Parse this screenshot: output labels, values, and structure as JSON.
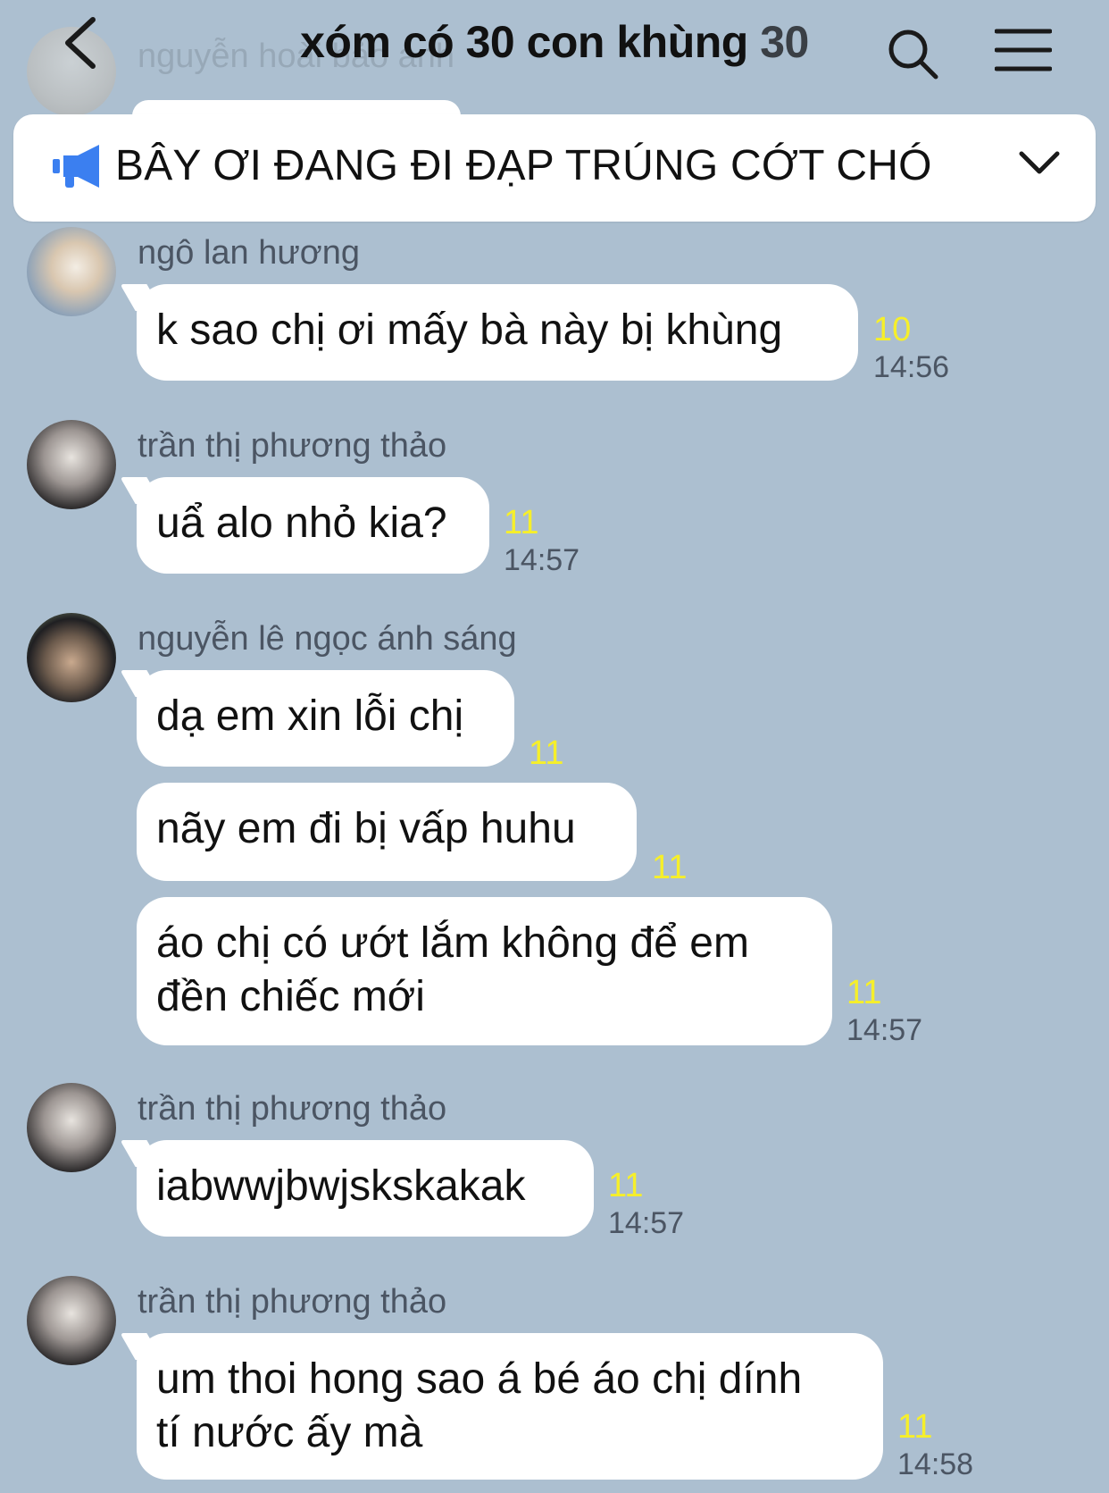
{
  "header": {
    "title": "xóm có 30 con khùng",
    "member_count": "30",
    "back_icon": "chevron-left-icon",
    "search_icon": "search-icon",
    "menu_icon": "hamburger-menu-icon"
  },
  "ghost": {
    "name": "nguyễn hoài bảo anh"
  },
  "pinned": {
    "icon": "megaphone-icon",
    "text": "BÂY ƠI ĐANG ĐI ĐẠP TRÚNG CỚT CHÓ"
  },
  "colors": {
    "background": "#acbfd0",
    "bubble": "#ffffff",
    "read_count": "#f6ef2a",
    "pin_icon": "#3b7ff0"
  },
  "messages": [
    {
      "sender": "ngô lan hương",
      "text": "k sao chị ơi mấy bà này bị khùng",
      "reads": "10",
      "time": "14:56"
    },
    {
      "sender": "trần thị phương thảo",
      "text": "uẩ alo nhỏ kia?",
      "reads": "11",
      "time": "14:57"
    },
    {
      "sender": "nguyễn lê ngọc ánh sáng",
      "text": "dạ em xin lỗi chị",
      "reads": "11"
    },
    {
      "text": "nãy em đi bị vấp huhu",
      "reads": "11"
    },
    {
      "text_line1": "áo chị có ướt lắm không để em",
      "text_line2": "đền chiếc mới",
      "reads": "11",
      "time": "14:57"
    },
    {
      "sender": "trần thị phương thảo",
      "text": "iabwwjbwjskskakak",
      "reads": "11",
      "time": "14:57"
    },
    {
      "sender": "trần thị phương thảo",
      "text_line1": "um thoi hong sao á bé áo chị dính",
      "text_line2": "tí nước ấy mà",
      "reads": "11",
      "time": "14:58"
    }
  ]
}
